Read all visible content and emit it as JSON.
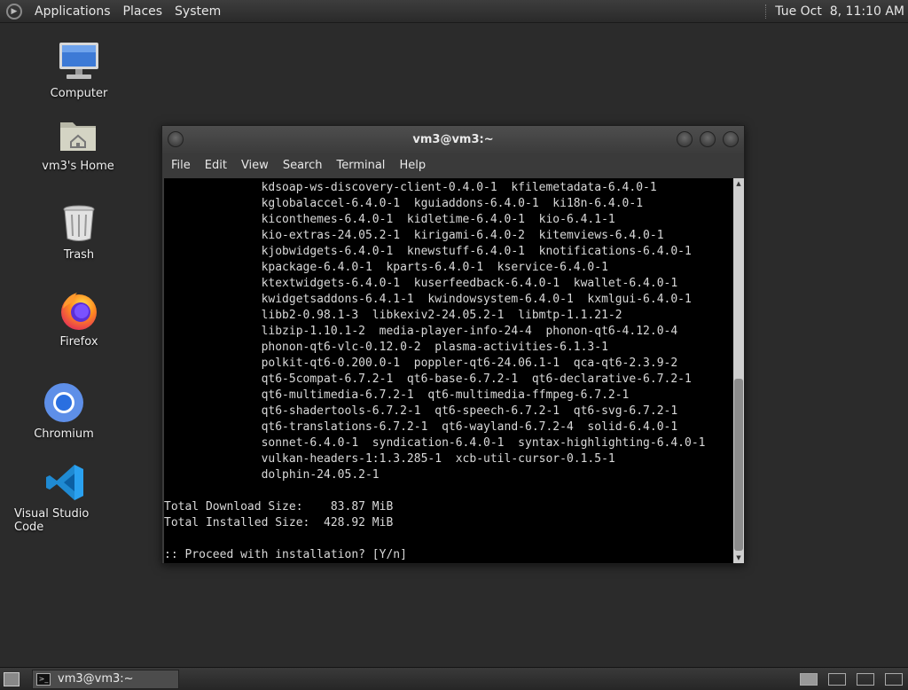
{
  "top_panel": {
    "menus": [
      "Applications",
      "Places",
      "System"
    ],
    "clock": "Tue Oct  8, 11:10 AM"
  },
  "desktop": {
    "icons": [
      {
        "label": "Computer",
        "icon": "computer-icon"
      },
      {
        "label": "vm3's Home",
        "icon": "home-folder-icon"
      },
      {
        "label": "Trash",
        "icon": "trash-icon"
      },
      {
        "label": "Firefox",
        "icon": "firefox-icon"
      },
      {
        "label": "Chromium",
        "icon": "chromium-icon"
      },
      {
        "label": "Visual Studio Code",
        "icon": "vscode-icon"
      }
    ]
  },
  "terminal": {
    "title": "vm3@vm3:~",
    "menu": [
      "File",
      "Edit",
      "View",
      "Search",
      "Terminal",
      "Help"
    ],
    "lines": [
      "              kdsoap-ws-discovery-client-0.4.0-1  kfilemetadata-6.4.0-1",
      "              kglobalaccel-6.4.0-1  kguiaddons-6.4.0-1  ki18n-6.4.0-1",
      "              kiconthemes-6.4.0-1  kidletime-6.4.0-1  kio-6.4.1-1",
      "              kio-extras-24.05.2-1  kirigami-6.4.0-2  kitemviews-6.4.0-1",
      "              kjobwidgets-6.4.0-1  knewstuff-6.4.0-1  knotifications-6.4.0-1",
      "              kpackage-6.4.0-1  kparts-6.4.0-1  kservice-6.4.0-1",
      "              ktextwidgets-6.4.0-1  kuserfeedback-6.4.0-1  kwallet-6.4.0-1",
      "              kwidgetsaddons-6.4.1-1  kwindowsystem-6.4.0-1  kxmlgui-6.4.0-1",
      "              libb2-0.98.1-3  libkexiv2-24.05.2-1  libmtp-1.1.21-2",
      "              libzip-1.10.1-2  media-player-info-24-4  phonon-qt6-4.12.0-4",
      "              phonon-qt6-vlc-0.12.0-2  plasma-activities-6.1.3-1",
      "              polkit-qt6-0.200.0-1  poppler-qt6-24.06.1-1  qca-qt6-2.3.9-2",
      "              qt6-5compat-6.7.2-1  qt6-base-6.7.2-1  qt6-declarative-6.7.2-1",
      "              qt6-multimedia-6.7.2-1  qt6-multimedia-ffmpeg-6.7.2-1",
      "              qt6-shadertools-6.7.2-1  qt6-speech-6.7.2-1  qt6-svg-6.7.2-1",
      "              qt6-translations-6.7.2-1  qt6-wayland-6.7.2-4  solid-6.4.0-1",
      "              sonnet-6.4.0-1  syndication-6.4.0-1  syntax-highlighting-6.4.0-1",
      "              vulkan-headers-1:1.3.285-1  xcb-util-cursor-0.1.5-1",
      "              dolphin-24.05.2-1",
      "",
      "Total Download Size:    83.87 MiB",
      "Total Installed Size:  428.92 MiB",
      "",
      ":: Proceed with installation? [Y/n]"
    ]
  },
  "bottom_panel": {
    "task_label": "vm3@vm3:~"
  }
}
